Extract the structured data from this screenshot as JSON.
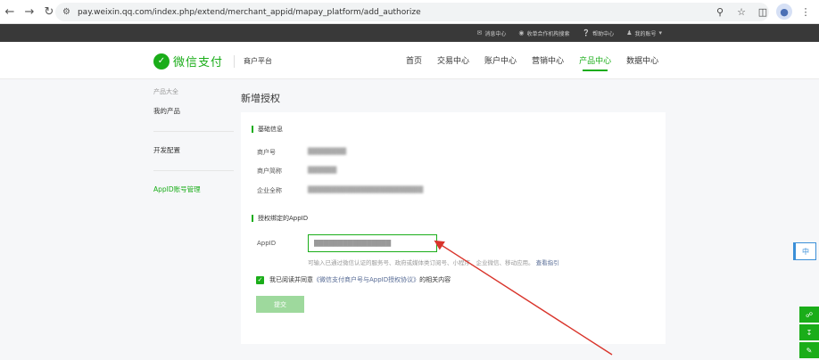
{
  "browser": {
    "url": "pay.weixin.qq.com/index.php/extend/merchant_appid/mapay_platform/add_authorize"
  },
  "topbar": {
    "items": [
      {
        "label": "消息中心"
      },
      {
        "label": "收单合作机构搜索"
      },
      {
        "label": "帮助中心"
      },
      {
        "label": "我的账号"
      }
    ]
  },
  "header": {
    "logo_text": "微信支付",
    "logo_sub": "商户平台",
    "nav": [
      {
        "label": "首页"
      },
      {
        "label": "交易中心"
      },
      {
        "label": "账户中心"
      },
      {
        "label": "营销中心"
      },
      {
        "label": "产品中心"
      },
      {
        "label": "数据中心"
      }
    ]
  },
  "sidebar": {
    "group_title": "产品大全",
    "items": [
      {
        "label": "我的产品"
      },
      {
        "label": "开发配置"
      },
      {
        "label": "AppID账号管理"
      }
    ]
  },
  "page": {
    "title": "新增授权"
  },
  "form": {
    "basic_title": "基础信息",
    "fields": [
      {
        "label": "商户号",
        "value": "████████"
      },
      {
        "label": "商户简称",
        "value": "██████"
      },
      {
        "label": "企业全称",
        "value": "████████████████████████"
      }
    ],
    "appid_section_title": "授权绑定的AppID",
    "appid_label": "AppID",
    "appid_value": "████████████████",
    "hint_text": "可输入已通过微信认证的服务号、政府或媒体类订阅号、小程序、企业微信、移动应用。",
    "hint_link": "查看指引",
    "agree_prefix": "我已阅读并同意",
    "agree_link": "《微信支付商户号与AppID授权协议》",
    "agree_suffix": "的相关内容",
    "submit_label": "提交"
  },
  "floating": {
    "lang_label": "中"
  },
  "colors": {
    "brand_green": "#1aad19",
    "link_blue": "#576b95",
    "annotation_red": "#d9342b"
  }
}
